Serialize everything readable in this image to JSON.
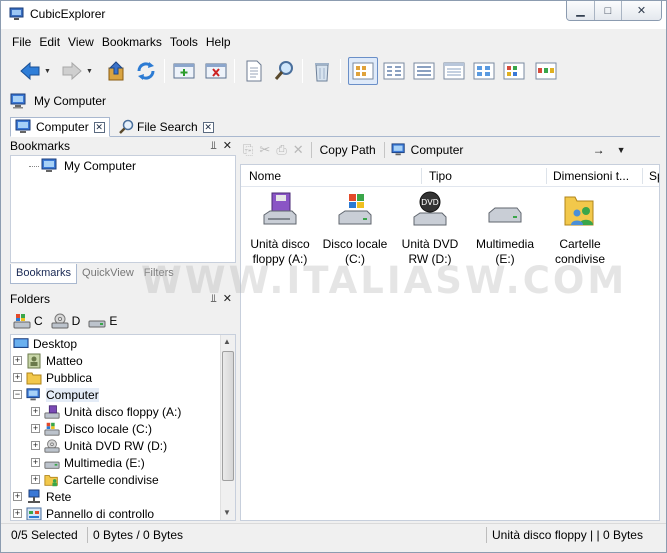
{
  "window": {
    "title": "CubicExplorer"
  },
  "menu": [
    "File",
    "Edit",
    "View",
    "Bookmarks",
    "Tools",
    "Help"
  ],
  "address_bar": {
    "text": "My Computer"
  },
  "tabs": [
    {
      "label": "Computer",
      "active": true
    },
    {
      "label": "File Search",
      "active": false
    }
  ],
  "bookmarks_panel": {
    "title": "Bookmarks",
    "items": [
      "My Computer"
    ]
  },
  "side_tabs": [
    "Bookmarks",
    "QuickView",
    "Filters"
  ],
  "folders_panel": {
    "title": "Folders",
    "drives": [
      "C",
      "D",
      "E"
    ],
    "tree": [
      {
        "label": "Desktop",
        "level": 0,
        "expander": ""
      },
      {
        "label": "Matteo",
        "level": 0,
        "expander": "+"
      },
      {
        "label": "Pubblica",
        "level": 0,
        "expander": "+"
      },
      {
        "label": "Computer",
        "level": 0,
        "expander": "−",
        "selected": true
      },
      {
        "label": "Unità disco floppy (A:)",
        "level": 1,
        "expander": "+"
      },
      {
        "label": "Disco locale (C:)",
        "level": 1,
        "expander": "+"
      },
      {
        "label": "Unità DVD RW (D:)",
        "level": 1,
        "expander": "+"
      },
      {
        "label": "Multimedia (E:)",
        "level": 1,
        "expander": "+"
      },
      {
        "label": "Cartelle condivise",
        "level": 1,
        "expander": "+"
      },
      {
        "label": "Rete",
        "level": 0,
        "expander": "+"
      },
      {
        "label": "Pannello di controllo",
        "level": 0,
        "expander": "+"
      }
    ]
  },
  "right_toolbar": {
    "copy_path": "Copy Path",
    "address": "Computer",
    "go": "→"
  },
  "columns": [
    "Nome",
    "Tipo",
    "Dimensioni t...",
    "Sp"
  ],
  "items": [
    {
      "line1": "Unità disco",
      "line2": "floppy (A:)",
      "icon": "floppy-drive-icon"
    },
    {
      "line1": "Disco locale",
      "line2": "(C:)",
      "icon": "hard-disk-windows-icon"
    },
    {
      "line1": "Unità DVD",
      "line2": "RW (D:)",
      "icon": "dvd-drive-icon"
    },
    {
      "line1": "Multimedia",
      "line2": "(E:)",
      "icon": "hard-disk-icon"
    },
    {
      "line1": "Cartelle",
      "line2": "condivise",
      "icon": "shared-folders-icon"
    }
  ],
  "watermark": "WWW.ITALIASW.COM",
  "status": {
    "selected": "0/5 Selected",
    "bytes": "0 Bytes / 0 Bytes",
    "right": "Unità disco floppy | | 0 Bytes"
  }
}
